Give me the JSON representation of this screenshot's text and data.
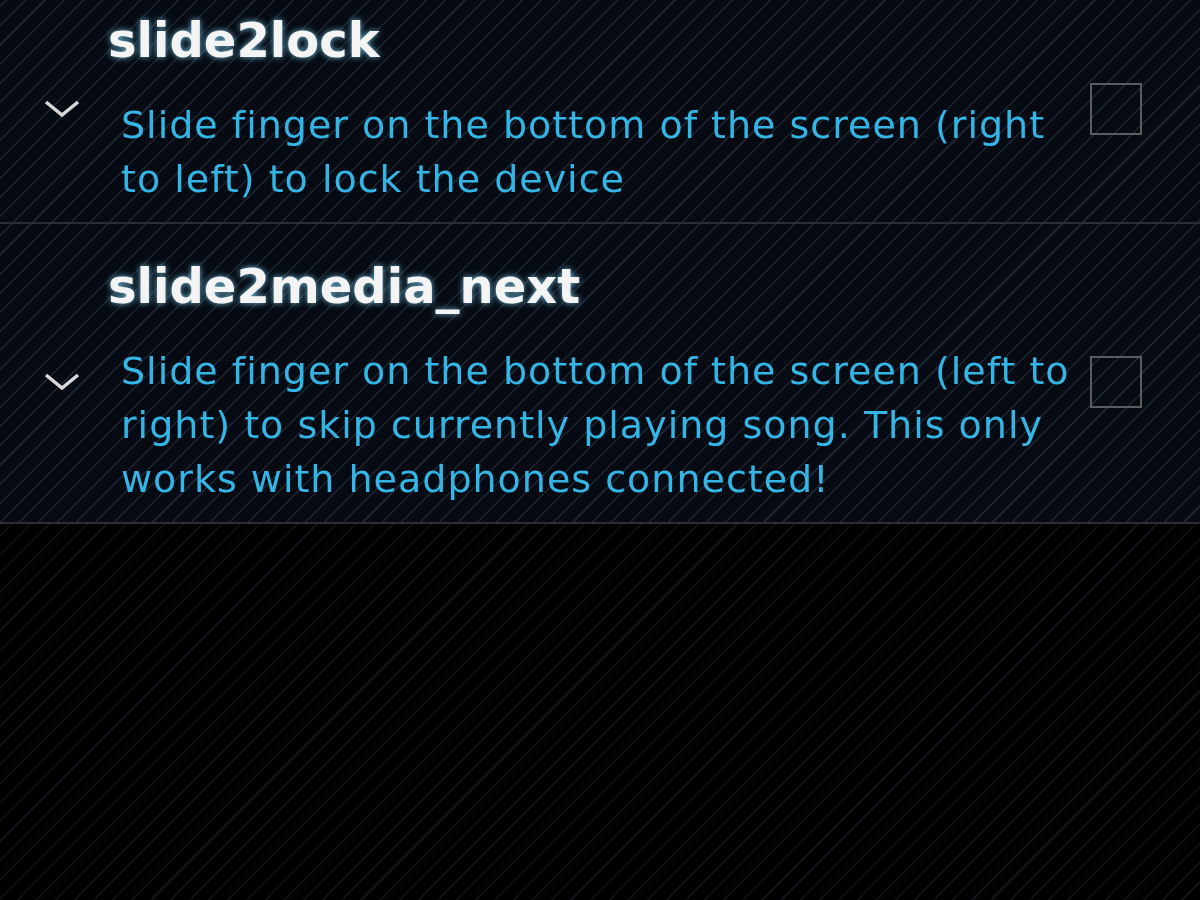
{
  "preferences": [
    {
      "title": "slide2lock",
      "summary": "Slide finger on the bottom of the screen (right to left) to lock the device",
      "checked": false
    },
    {
      "title": "slide2media_next",
      "summary": "Slide finger on the bottom of the screen (left to right) to skip currently playing song. This only works with headphones connected!",
      "checked": false
    }
  ]
}
